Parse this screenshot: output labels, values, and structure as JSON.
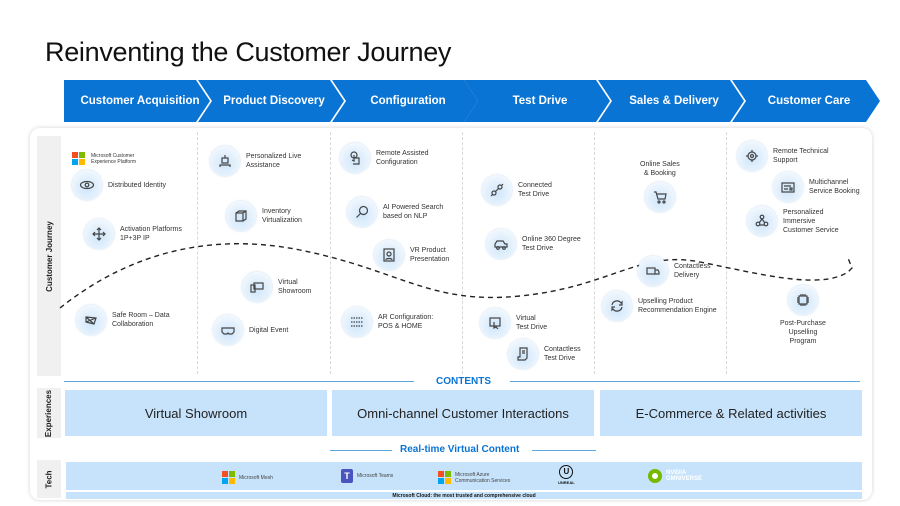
{
  "title": "Reinventing the Customer Journey",
  "stages": [
    {
      "label": "Customer Acquisition"
    },
    {
      "label": "Product Discovery"
    },
    {
      "label": "Configuration"
    },
    {
      "label": "Test Drive"
    },
    {
      "label": "Sales & Delivery"
    },
    {
      "label": "Customer Care"
    }
  ],
  "rows": {
    "journey": "Customer Journey",
    "experiences": "Experiences",
    "tech": "Tech"
  },
  "journey_items": {
    "acquisition": [
      {
        "label": "Microsoft Customer\nExperience Platform",
        "icon": "microsoft-logo"
      },
      {
        "label": "Distributed Identity",
        "icon": "eye-icon"
      },
      {
        "label": "Activation  Platforms\n1P+3P IP",
        "icon": "arrows-expand-icon"
      },
      {
        "label": "Safe Room – Data\nCollaboration",
        "icon": "network-icon"
      }
    ],
    "discovery": [
      {
        "label": "Personalized Live\nAssistance",
        "icon": "robot-icon"
      },
      {
        "label": "Inventory\nVirtualization",
        "icon": "cube-icon"
      },
      {
        "label": "Virtual\nShowroom",
        "icon": "devices-icon"
      },
      {
        "label": "Digital Event",
        "icon": "vr-headset-icon"
      }
    ],
    "configuration": [
      {
        "label": "Remote Assisted\nConfiguration",
        "icon": "touch-icon"
      },
      {
        "label": "AI Powered Search\nbased on NLP",
        "icon": "search-icon"
      },
      {
        "label": "VR Product\nPresentation",
        "icon": "presentation-icon"
      },
      {
        "label": "AR Configuration:\nPOS & HOME",
        "icon": "binary-icon"
      }
    ],
    "test_drive": [
      {
        "label": "Connected\nTest Drive",
        "icon": "link-icon"
      },
      {
        "label": "Online 360 Degree\nTest Drive",
        "icon": "car-icon"
      },
      {
        "label": "Virtual\nTest Drive",
        "icon": "monitor-hand-icon"
      },
      {
        "label": "Contactless\nTest Drive",
        "icon": "document-icon"
      }
    ],
    "sales": [
      {
        "label": "Online Sales\n& Booking",
        "icon": "cart-icon"
      },
      {
        "label": "Contactless\nDelivery",
        "icon": "truck-icon"
      },
      {
        "label": "Upselling Product\nRecommendation Engine",
        "icon": "refresh-icon"
      }
    ],
    "care": [
      {
        "label": "Remote Technical\nSupport",
        "icon": "gear-search-icon"
      },
      {
        "label": "Multichannel\nService Booking",
        "icon": "form-icon"
      },
      {
        "label": "Personalized\nImmersive\nCustomer Service",
        "icon": "people-icon"
      },
      {
        "label": "Post-Purchase\nUpselling\nProgram",
        "icon": "chip-icon"
      }
    ]
  },
  "contents_heading": "CONTENTS",
  "experiences": [
    {
      "label": "Virtual Showroom"
    },
    {
      "label": "Omni-channel  Customer Interactions"
    },
    {
      "label": "E-Commerce & Related activities"
    }
  ],
  "realtime_heading": "Real-time Virtual Content",
  "tech": {
    "logos": [
      {
        "label": "Microsoft Mesh",
        "icon": "microsoft-logo"
      },
      {
        "label": "Microsoft Teams",
        "icon": "teams-logo"
      },
      {
        "label": "Microsoft Azure\nCommunication Services",
        "icon": "microsoft-logo"
      },
      {
        "label": "UNREAL",
        "icon": "unreal-logo"
      },
      {
        "label": "NVIDIA\nOMNIVERSE",
        "icon": "nvidia-logo"
      }
    ],
    "footer": "Microsoft Cloud: the most trusted and comprehensive cloud"
  },
  "colors": {
    "accent": "#0a74d4",
    "light_band": "#c7e3fb"
  }
}
